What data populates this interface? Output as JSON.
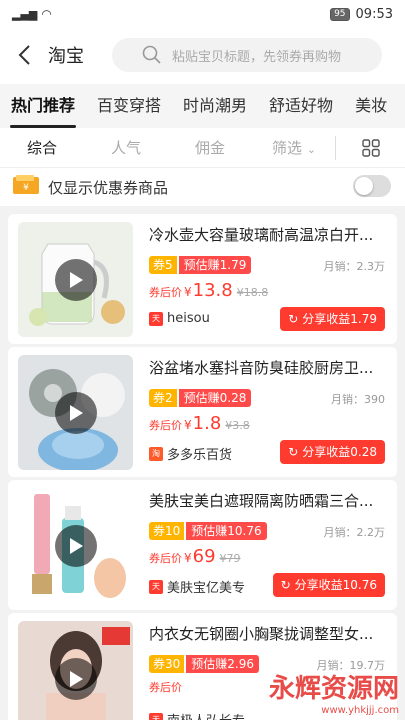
{
  "status": {
    "signal": "4G",
    "battery": "95",
    "time": "09:53"
  },
  "header": {
    "title": "淘宝",
    "search_placeholder": "粘贴宝贝标题，先领券再购物"
  },
  "tabs": [
    "热门推荐",
    "百变穿搭",
    "时尚潮男",
    "舒适好物",
    "美妆"
  ],
  "filters": {
    "f1": "综合",
    "f2": "人气",
    "f3": "佣金",
    "f4": "筛选"
  },
  "coupon_row": {
    "label": "仅显示优惠券商品"
  },
  "products": [
    {
      "title": "冷水壶大容量玻璃耐高温凉白开...",
      "coupon": "券5",
      "earn": "预估赚1.79",
      "sales": "月销：2.3万",
      "price_label": "券后价",
      "currency": "¥",
      "price": "13.8",
      "old_price": "¥18.8",
      "shop": "heisou",
      "shop_badge": "天猫",
      "share": "分享收益1.79"
    },
    {
      "title": "浴盆堵水塞抖音防臭硅胶厨房卫...",
      "coupon": "券2",
      "earn": "预估赚0.28",
      "sales": "月销：390",
      "price_label": "券后价",
      "currency": "¥",
      "price": "1.8",
      "old_price": "¥3.8",
      "shop": "多多乐百货",
      "shop_badge": "淘",
      "share": "分享收益0.28"
    },
    {
      "title": "美肤宝美白遮瑕隔离防晒霜三合...",
      "coupon": "券10",
      "earn": "预估赚10.76",
      "sales": "月销：2.2万",
      "price_label": "券后价",
      "currency": "¥",
      "price": "69",
      "old_price": "¥79",
      "shop": "美肤宝亿美专",
      "shop_badge": "天猫",
      "share": "分享收益10.76"
    },
    {
      "title": "内衣女无钢圈小胸聚拢调整型女...",
      "coupon": "券30",
      "earn": "预估赚2.96",
      "sales": "月销：19.7万",
      "price_label": "券后价",
      "currency": "¥",
      "price": "",
      "old_price": "",
      "shop": "南极人弘长专",
      "shop_badge": "天猫",
      "share": ""
    }
  ],
  "watermark": {
    "main": "永辉资源网",
    "sub": "www.yhkjjj.com"
  },
  "colors": {
    "accent": "#ff3b30",
    "coupon": "#ffb500",
    "tab_bg": "#f5f5f5"
  }
}
